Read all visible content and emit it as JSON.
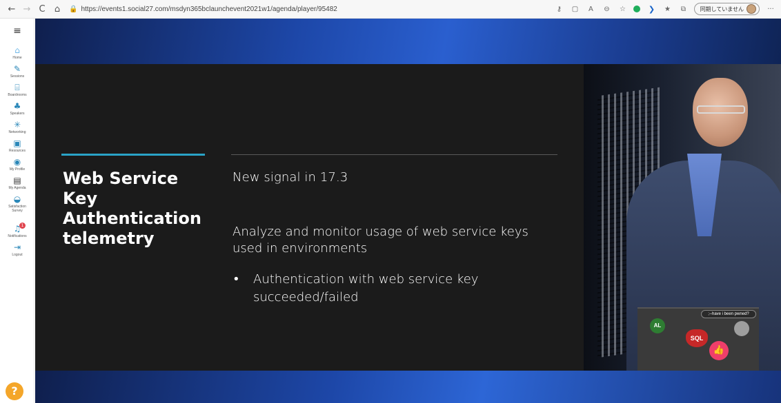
{
  "browser": {
    "back_label": "←",
    "forward_label": "→",
    "reload_label": "C",
    "home_label": "⌂",
    "url": "https://events1.social27.com/msdyn365bclaunchevent2021w1/agenda/player/95482",
    "sync_label": "同期していません",
    "more_label": "···"
  },
  "sidebar": {
    "menu_icon": "≡",
    "items": [
      {
        "label": "Home",
        "icon": "home-icon"
      },
      {
        "label": "Sessions",
        "icon": "pen-icon"
      },
      {
        "label": "Boardrooms",
        "icon": "boardroom-icon"
      },
      {
        "label": "Speakers",
        "icon": "speaker-icon"
      },
      {
        "label": "Networking",
        "icon": "network-icon"
      },
      {
        "label": "Resources",
        "icon": "resources-icon"
      },
      {
        "label": "My Profile",
        "icon": "profile-icon"
      },
      {
        "label": "My Agenda",
        "icon": "calendar-icon"
      },
      {
        "label": "Satisfaction Survey",
        "icon": "survey-icon"
      },
      {
        "label": "Notifications",
        "icon": "bell-icon",
        "badge": "1"
      },
      {
        "label": "Logout",
        "icon": "logout-icon"
      }
    ],
    "help_label": "?"
  },
  "slide": {
    "title": "Web Service Key Authentication telemetry",
    "subtitle": "New signal in 17.3",
    "body": "Analyze and monitor usage of web service keys used in environments",
    "bullet": "Authentication with web service key succeeded/failed"
  },
  "video": {
    "sticker_al": "AL",
    "sticker_sql": "SQL",
    "sticker_pwned": ";--have i been pwned?"
  },
  "like_icon": "thumbs-up-icon",
  "colors": {
    "accent": "#2aa3c7",
    "slide_bg": "#1b1b1b",
    "like": "#ef3e6a",
    "help": "#f4a62a",
    "sidebar_icon": "#2a87b8"
  }
}
